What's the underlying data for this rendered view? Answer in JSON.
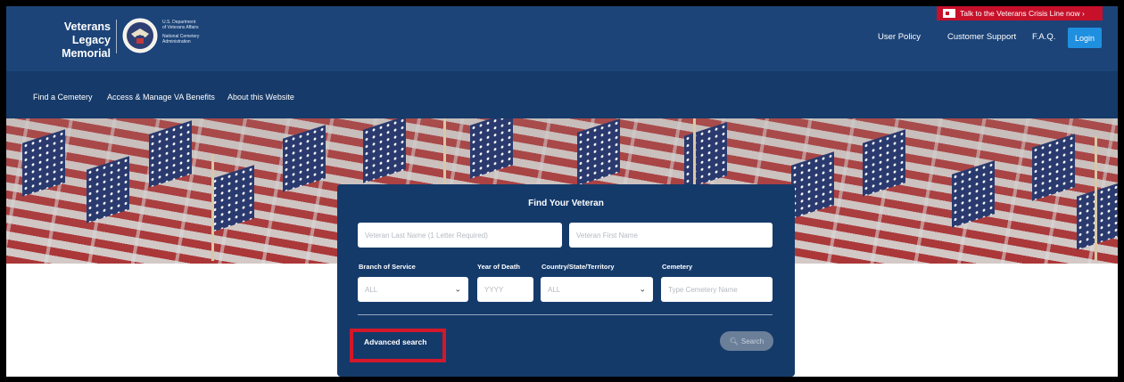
{
  "header": {
    "logo_line1": "Veterans Legacy",
    "logo_line2": "Memorial",
    "agency_line1": "U.S. Department",
    "agency_line2": "of Veterans Affairs",
    "agency_line3": "National Cemetery",
    "agency_line4": "Administration",
    "crisis_label": "Talk to the Veterans Crisis Line now ›",
    "links": [
      "User Policy",
      "Customer Support",
      "F.A.Q."
    ],
    "login_label": "Login"
  },
  "nav": {
    "items": [
      "Find a Cemetery",
      "Access & Manage VA Benefits",
      "About this Website"
    ]
  },
  "search": {
    "title": "Find Your Veteran",
    "last_name_placeholder": "Veteran Last Name (1 Letter Required)",
    "first_name_placeholder": "Veteran First Name",
    "branch_label": "Branch of Service",
    "branch_value": "ALL",
    "year_label": "Year of Death",
    "year_placeholder": "YYYY",
    "country_label": "Country/State/Territory",
    "country_value": "ALL",
    "cemetery_label": "Cemetery",
    "cemetery_placeholder": "Type Cemetery Name",
    "advanced_label": "Advanced search",
    "search_label": "Search"
  },
  "colors": {
    "header_bg": "#1c4478",
    "nav_bg": "#163a69",
    "card_bg": "#143a6a",
    "crisis_red": "#c7102a",
    "login_blue": "#1f8fe0",
    "highlight_red": "#d2182a"
  }
}
